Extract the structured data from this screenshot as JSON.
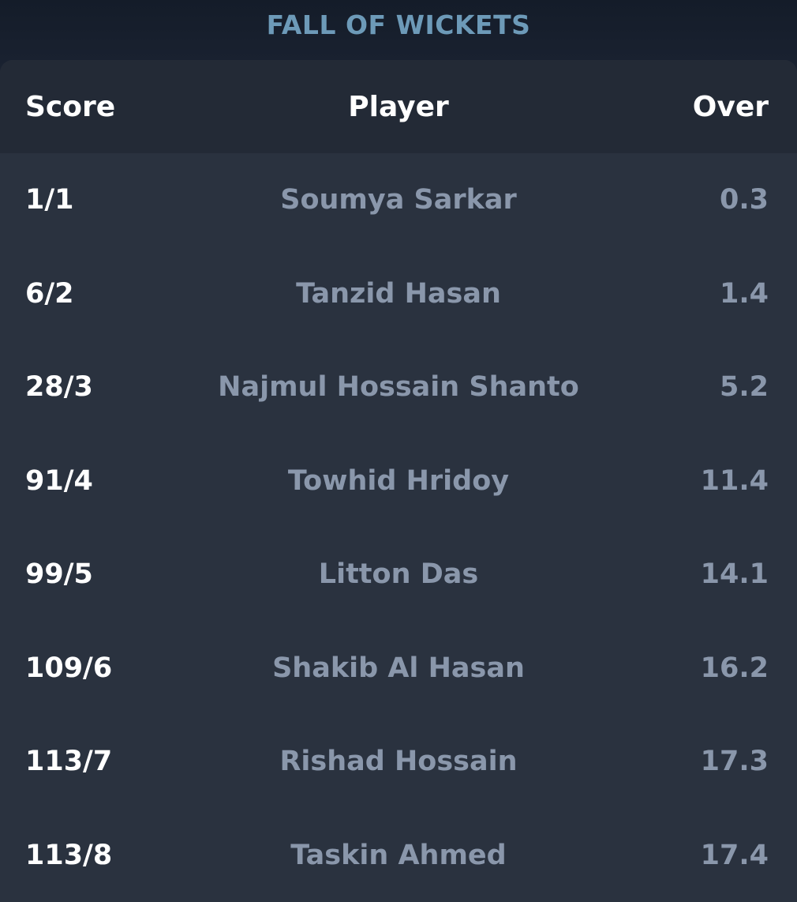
{
  "section": {
    "title": "FALL OF WICKETS"
  },
  "table": {
    "headers": {
      "score": "Score",
      "player": "Player",
      "over": "Over"
    },
    "rows": [
      {
        "score": "1/1",
        "player": "Soumya Sarkar",
        "over": "0.3"
      },
      {
        "score": "6/2",
        "player": "Tanzid Hasan",
        "over": "1.4"
      },
      {
        "score": "28/3",
        "player": "Najmul Hossain Shanto",
        "over": "5.2"
      },
      {
        "score": "91/4",
        "player": "Towhid Hridoy",
        "over": "11.4"
      },
      {
        "score": "99/5",
        "player": "Litton Das",
        "over": "14.1"
      },
      {
        "score": "109/6",
        "player": "Shakib Al Hasan",
        "over": "16.2"
      },
      {
        "score": "113/7",
        "player": "Rishad Hossain",
        "over": "17.3"
      },
      {
        "score": "113/8",
        "player": "Taskin Ahmed",
        "over": "17.4"
      }
    ]
  },
  "colors": {
    "title": "#6d9ab8",
    "card_bg": "#2a323f",
    "header_bg": "#232a36",
    "score_text": "#ffffff",
    "muted_text": "#8a97ab"
  }
}
